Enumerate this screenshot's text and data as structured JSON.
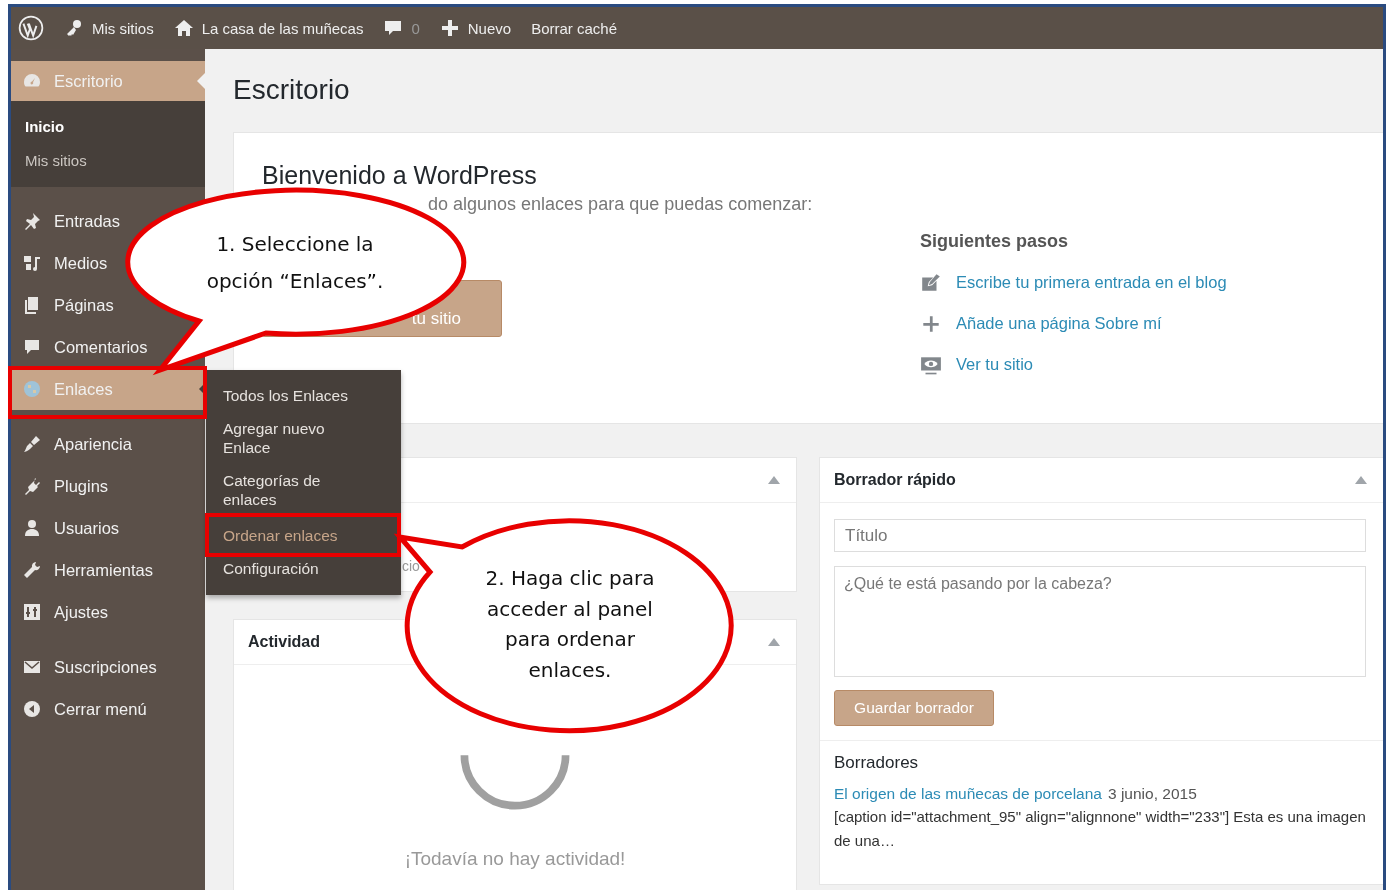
{
  "admin_bar": {
    "items": [
      {
        "kind": "logo"
      },
      {
        "kind": "sites",
        "label": "Mis sitios"
      },
      {
        "kind": "home",
        "label": "La casa de las muñecas"
      },
      {
        "kind": "comments",
        "label": "0"
      },
      {
        "kind": "new",
        "label": "Nuevo"
      },
      {
        "kind": "plain",
        "label": "Borrar caché"
      }
    ]
  },
  "sidebar": {
    "groups": [
      {
        "items": [
          {
            "label": "Escritorio",
            "selected": true,
            "highlighted": false,
            "children": [
              {
                "label": "Inicio",
                "selected": true
              },
              {
                "label": "Mis sitios",
                "selected": false
              }
            ]
          }
        ]
      },
      {
        "items": [
          {
            "label": "Entradas",
            "selected": false,
            "highlighted": false
          },
          {
            "label": "Medios",
            "selected": false,
            "highlighted": false
          },
          {
            "label": "Páginas",
            "selected": false,
            "highlighted": false
          },
          {
            "label": "Comentarios",
            "selected": false,
            "highlighted": false
          },
          {
            "label": "Enlaces",
            "selected": false,
            "highlighted": true
          }
        ]
      },
      {
        "items": [
          {
            "label": "Apariencia",
            "selected": false,
            "highlighted": false
          },
          {
            "label": "Plugins",
            "selected": false,
            "highlighted": false
          },
          {
            "label": "Usuarios",
            "selected": false,
            "highlighted": false
          },
          {
            "label": "Herramientas",
            "selected": false,
            "highlighted": false
          },
          {
            "label": "Ajustes",
            "selected": false,
            "highlighted": false
          }
        ]
      },
      {
        "items": [
          {
            "label": "Suscripciones",
            "selected": false,
            "highlighted": false
          },
          {
            "label": "Cerrar menú",
            "selected": false,
            "highlighted": false
          }
        ]
      }
    ]
  },
  "flyout": {
    "items": [
      {
        "label": "Todos los Enlaces",
        "selected": false
      },
      {
        "label": "Agregar nuevo Enlace",
        "selected": false
      },
      {
        "label": "Categorías de enlaces",
        "selected": false
      },
      {
        "label": "Ordenar enlaces",
        "selected": true
      }
    ],
    "last": {
      "label": "Configuración",
      "selected": false
    }
  },
  "page_title": "Escritorio",
  "welcome": {
    "title": "Bienvenido a WordPress",
    "subtitle": "do algunos enlaces para que puedas comenzar:",
    "button": "tu sitio",
    "next_steps": {
      "title": "Siguientes pasos",
      "links": [
        {
          "kind": "write",
          "label": "Escribe tu primera entrada en el blog"
        },
        {
          "kind": "add",
          "label": "Añade una página Sobre mí"
        },
        {
          "kind": "view",
          "label": "Ver tu sitio"
        }
      ]
    }
  },
  "left_widgets": [
    {
      "kind": "partial",
      "body": "cio"
    },
    {
      "kind": "activity",
      "title": "Actividad",
      "empty_text": "¡Todavía no hay actividad!"
    }
  ],
  "quick_draft": {
    "title": "Borrador rápido",
    "title_placeholder": "Título",
    "content_placeholder": "¿Qué te está pasando por la cabeza?",
    "button": "Guardar borrador",
    "drafts_heading": "Borradores",
    "drafts": [
      {
        "title": "El origen de las muñecas de porcelana",
        "date": "3 junio, 2015",
        "excerpt": "[caption id=\"attachment_95\" align=\"alignnone\" width=\"233\"] Esta es una imagen de una…"
      }
    ]
  },
  "annotations": [
    {
      "text": "1. Seleccione la opción “Enlaces”."
    },
    {
      "text": "2. Haga clic para acceder al panel para ordenar enlaces."
    }
  ]
}
